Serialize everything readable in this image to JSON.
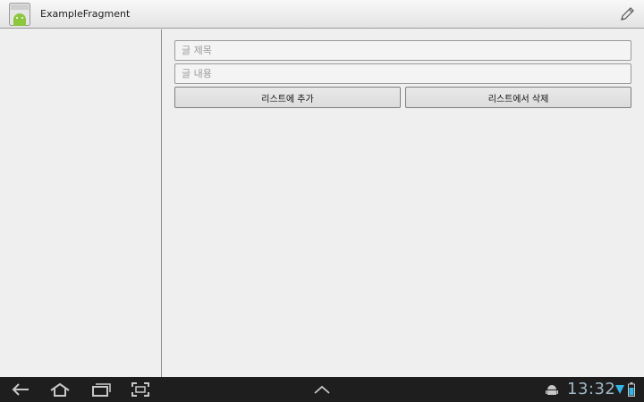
{
  "action_bar": {
    "title": "ExampleFragment",
    "icons": {
      "app": "android-app-icon",
      "edit": "pencil-icon"
    }
  },
  "form": {
    "title_placeholder": "글 제목",
    "title_value": "",
    "content_placeholder": "글 내용",
    "content_value": "",
    "add_button": "리스트에 추가",
    "delete_button": "리스트에서 삭제"
  },
  "system_bar": {
    "time": "13:32",
    "nav_icons": [
      "back-icon",
      "home-icon",
      "recent-apps-icon",
      "screenshot-icon"
    ],
    "center_icon": "chevron-up-icon",
    "status_icons": [
      "android-debug-icon",
      "wifi-icon",
      "battery-icon"
    ]
  },
  "colors": {
    "background": "#efefef",
    "system_bar": "#1e1e1e",
    "clock": "#9fb8c6",
    "accent_green": "#8dc63f"
  }
}
